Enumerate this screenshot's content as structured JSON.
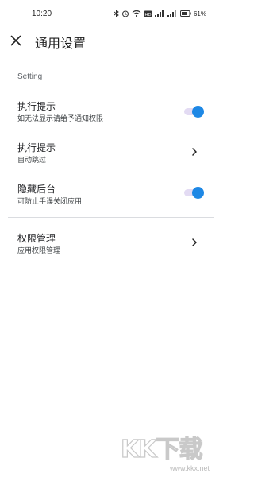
{
  "status_bar": {
    "time": "10:20",
    "battery_percent": "61%"
  },
  "header": {
    "title": "通用设置"
  },
  "section": {
    "label": "Setting"
  },
  "settings": [
    {
      "title": "执行提示",
      "subtitle": "如无法显示请给予通知权限",
      "control": "toggle",
      "on": true
    },
    {
      "title": "执行提示",
      "subtitle": "自动跳过",
      "control": "chevron"
    },
    {
      "title": "隐藏后台",
      "subtitle": "可防止手误关闭应用",
      "control": "toggle",
      "on": true
    },
    {
      "title": "权限管理",
      "subtitle": "应用权限管理",
      "control": "chevron"
    }
  ],
  "colors": {
    "accent": "#1e88e5",
    "toggle_track": "#e3dbf3",
    "divider": "#dadce0"
  },
  "watermark": {
    "text": "KK下载",
    "url": "www.kkx.net"
  }
}
